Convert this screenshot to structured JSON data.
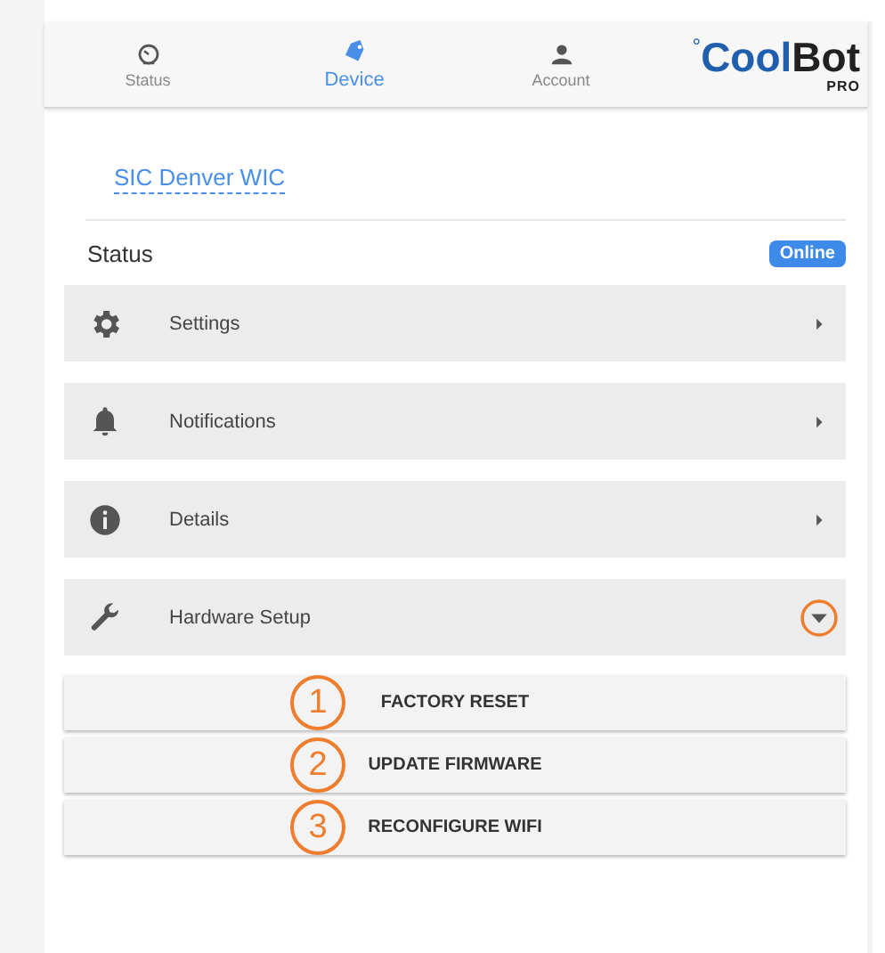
{
  "tabs": [
    {
      "label": "Status",
      "kind": "gauge",
      "selected": false
    },
    {
      "label": "Device",
      "kind": "tag",
      "selected": true
    },
    {
      "label": "Account",
      "kind": "person",
      "selected": false
    }
  ],
  "logo": {
    "mark": "°",
    "first": "Cool",
    "second": "Bot",
    "sub": "PRO"
  },
  "device_name": "SIC Denver WIC",
  "status": {
    "label": "Status",
    "badge": "Online"
  },
  "menu": [
    {
      "label": "Settings",
      "kind": "gear",
      "expanded": false,
      "highlighted": false
    },
    {
      "label": "Notifications",
      "kind": "bell",
      "expanded": false,
      "highlighted": false
    },
    {
      "label": "Details",
      "kind": "info",
      "expanded": false,
      "highlighted": false
    },
    {
      "label": "Hardware Setup",
      "kind": "wrench",
      "expanded": true,
      "highlighted": true
    }
  ],
  "actions": [
    {
      "label": "FACTORY RESET",
      "callout": "1"
    },
    {
      "label": "UPDATE FIRMWARE",
      "callout": "2"
    },
    {
      "label": "RECONFIGURE WIFI",
      "callout": "3"
    }
  ]
}
